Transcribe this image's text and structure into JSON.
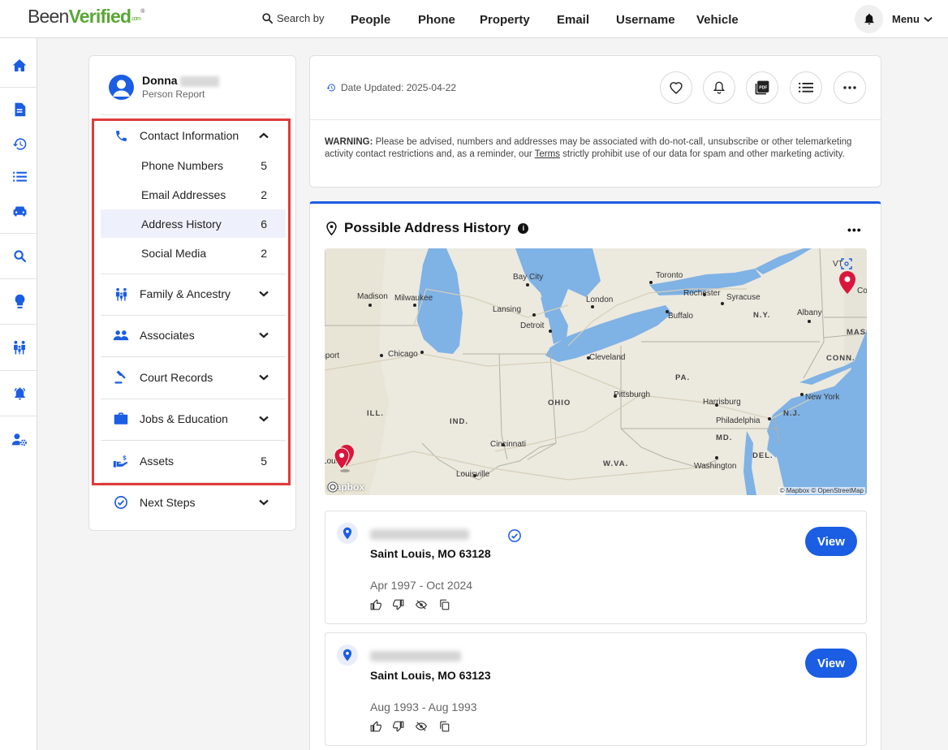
{
  "header": {
    "logo_been": "Been",
    "logo_verified": "Verified",
    "logo_com": ".com",
    "search_by": "Search by",
    "nav": [
      "People",
      "Phone",
      "Property",
      "Email",
      "Username",
      "Vehicle"
    ],
    "menu": "Menu"
  },
  "profile": {
    "first_name": "Donna",
    "subtitle": "Person Report"
  },
  "sidebar": {
    "contact": {
      "label": "Contact Information",
      "items": [
        {
          "label": "Phone Numbers",
          "count": "5"
        },
        {
          "label": "Email Addresses",
          "count": "2"
        },
        {
          "label": "Address History",
          "count": "6"
        },
        {
          "label": "Social Media",
          "count": "2"
        }
      ]
    },
    "sections": [
      {
        "label": "Family & Ancestry"
      },
      {
        "label": "Associates"
      },
      {
        "label": "Court Records"
      },
      {
        "label": "Jobs & Education"
      },
      {
        "label": "Assets",
        "count": "5"
      },
      {
        "label": "Next Steps"
      }
    ]
  },
  "report": {
    "date_updated": "Date Updated: 2025-04-22",
    "warning_bold": "WARNING:",
    "warning_text1": " Please be advised, numbers and addresses may be associated with do-not-call, unsubscribe or other telemarketing activity contact restrictions and, as a reminder, our ",
    "warning_terms": "Terms",
    "warning_text2": " strictly prohibit use of our data for spam and other marketing activity.",
    "pdf_label": "PDF"
  },
  "address_history": {
    "title": "Possible Address History",
    "map": {
      "cities": [
        "Toronto",
        "Bay City",
        "Madison",
        "Milwaukee",
        "London",
        "Rochester",
        "Syracuse",
        "Lansing",
        "Buffalo",
        "Albany",
        "Detroit",
        "Chicago",
        "Cleveland",
        "Davenport",
        "Pittsburgh",
        "New York",
        "Harrisburg",
        "Philadelphia",
        "Cincinnati",
        "Washington",
        "Louisville",
        "St. Louis",
        "VT",
        "Co"
      ],
      "states": [
        "N.Y.",
        "MASS.",
        "CONN.",
        "PA.",
        "OHIO",
        "ILL.",
        "IND.",
        "N.J.",
        "MD.",
        "DEL.",
        "W.VA."
      ],
      "attribution": "© Mapbox © OpenStreetMap",
      "logo": "mapbox"
    },
    "entries": [
      {
        "city": "Saint Louis, MO 63128",
        "dates": "Apr 1997 - Oct 2024",
        "verified": true,
        "view": "View"
      },
      {
        "city": "Saint Louis, MO 63123",
        "dates": "Aug 1993 - Aug 1993",
        "verified": false,
        "view": "View"
      }
    ]
  },
  "colors": {
    "brand_blue": "#1b5de3",
    "brand_green": "#5aa636",
    "highlight_red": "#e23a3a",
    "pin_red": "#d9163b"
  }
}
